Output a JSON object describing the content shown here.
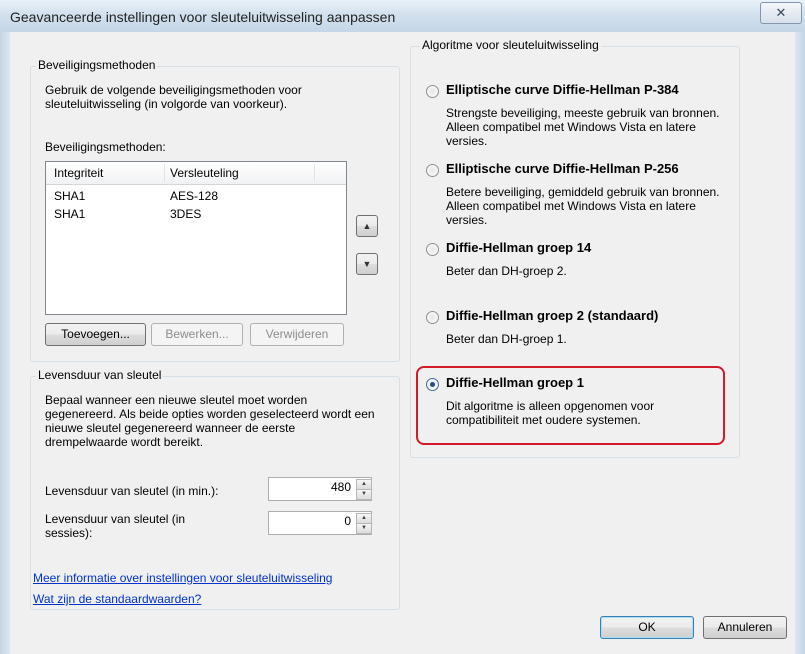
{
  "window": {
    "title": "Geavanceerde instellingen voor sleuteluitwisseling aanpassen",
    "close_glyph": "✕"
  },
  "security_methods": {
    "group_title": "Beveiligingsmethoden",
    "description": "Gebruik de volgende beveiligingsmethoden voor sleuteluitwisseling (in volgorde van voorkeur).",
    "list_label": "Beveiligingsmethoden:",
    "columns": [
      "Integriteit",
      "Versleuteling"
    ],
    "rows": [
      [
        "SHA1",
        "AES-128"
      ],
      [
        "SHA1",
        "3DES"
      ]
    ],
    "move_up_icon": "arrow-up-icon",
    "move_down_icon": "arrow-down-icon",
    "add_label": "Toevoegen...",
    "edit_label": "Bewerken...",
    "remove_label": "Verwijderen"
  },
  "key_lifetime": {
    "group_title": "Levensduur van sleutel",
    "description": "Bepaal wanneer een nieuwe sleutel moet worden gegenereerd. Als beide opties worden geselecteerd wordt een nieuwe sleutel gegenereerd wanneer de eerste drempelwaarde wordt bereikt.",
    "minutes_label": "Levensduur van sleutel (in min.):",
    "minutes_value": "480",
    "sessions_label": "Levensduur van sleutel (in sessies):",
    "sessions_value": "0"
  },
  "links": {
    "more_info": "Meer informatie over instellingen voor sleuteluitwisseling",
    "defaults": "Wat zijn de standaardwaarden?"
  },
  "algorithm": {
    "group_title": "Algoritme voor sleuteluitwisseling",
    "options": [
      {
        "label": "Elliptische curve Diffie-Hellman P-384",
        "description": "Strengste beveiliging, meeste gebruik van bronnen. Alleen compatibel met Windows Vista en latere versies.",
        "checked": false
      },
      {
        "label": "Elliptische curve Diffie-Hellman P-256",
        "description": "Betere beveiliging, gemiddeld gebruik van bronnen. Alleen compatibel met Windows Vista en latere versies.",
        "checked": false
      },
      {
        "label": "Diffie-Hellman groep 14",
        "description": "Beter dan DH-groep 2.",
        "checked": false
      },
      {
        "label": "Diffie-Hellman groep 2 (standaard)",
        "description": "Beter dan DH-groep 1.",
        "checked": false
      },
      {
        "label": "Diffie-Hellman groep 1",
        "description": "Dit algoritme is alleen opgenomen voor compatibiliteit met oudere systemen.",
        "checked": true
      }
    ],
    "highlight_color": "#d21a2a"
  },
  "buttons": {
    "ok": "OK",
    "cancel": "Annuleren"
  }
}
